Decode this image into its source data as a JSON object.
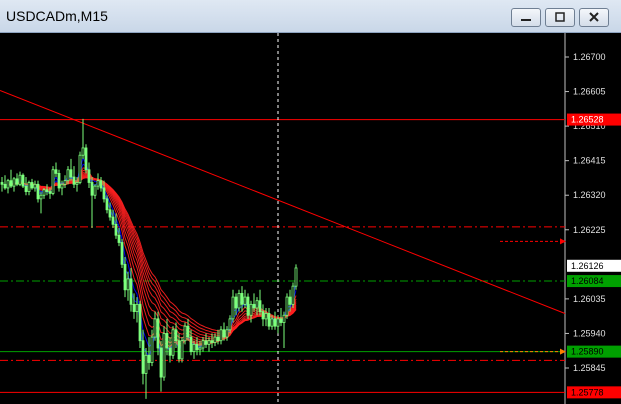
{
  "window": {
    "title": "USDCADm,M15"
  },
  "controls": [
    {
      "name": "minimize-button",
      "icon": "minimize-icon"
    },
    {
      "name": "restore-button",
      "icon": "restore-icon"
    },
    {
      "name": "close-button",
      "icon": "close-icon"
    }
  ],
  "colors": {
    "background": "#000000",
    "axis": "#c0c0c0",
    "grid": "#ffffff",
    "candle_bull": "#7cff7c",
    "candle_bear": "#7cff7c",
    "ribbon": "#ff2020",
    "ribbon_fast_bull": "#0000ff",
    "level_line": "#ff0000",
    "green_level": "#00a000"
  },
  "chart_data": {
    "type": "candlestick",
    "symbol": "USDCADm",
    "timeframe": "M15",
    "ylim": [
      1.25746,
      1.26766
    ],
    "price_ticks": [
      "1.26700",
      "1.26605",
      "1.26510",
      "1.26415",
      "1.26320",
      "1.26225",
      "1.26035",
      "1.25940",
      "1.25845",
      "1.25750"
    ],
    "current_price": "1.26126",
    "price_labels": [
      {
        "text": "1.26528",
        "price": 1.26528,
        "bg": "#ff0000",
        "fg": "#ffffff"
      },
      {
        "text": "1.26126",
        "price": 1.26126,
        "bg": "#ffffff",
        "fg": "#000000"
      },
      {
        "text": "1.26084",
        "price": 1.26084,
        "bg": "#00a000",
        "fg": "#000000"
      },
      {
        "text": "1.25890",
        "price": 1.2589,
        "bg": "#00a000",
        "fg": "#000000"
      },
      {
        "text": "1.25778",
        "price": 1.25778,
        "bg": "#ff0000",
        "fg": "#000000"
      }
    ],
    "horizontal_lines": [
      {
        "price": 1.26528,
        "style": "solid",
        "color": "#ff0000"
      },
      {
        "price": 1.26233,
        "style": "dashdot",
        "color": "#ff0000"
      },
      {
        "price": 1.26084,
        "style": "dashdot",
        "color": "#00a000"
      },
      {
        "price": 1.2589,
        "style": "solid",
        "color": "#00a000"
      },
      {
        "price": 1.25866,
        "style": "dashdot",
        "color": "#ff0000"
      },
      {
        "price": 1.25778,
        "style": "solid",
        "color": "#ff0000"
      }
    ],
    "trendline": {
      "from": [
        0,
        1.26606
      ],
      "to": [
        140,
        1.2615
      ],
      "color": "#ff0000"
    },
    "arrows": [
      {
        "price": 1.26193,
        "color": "#ff0000"
      },
      {
        "price": 1.2589,
        "color": "#ff8000"
      }
    ],
    "crosshair_bar": 92,
    "candles": [
      [
        1.26355,
        1.2637,
        1.2633,
        1.2635
      ],
      [
        1.2635,
        1.26375,
        1.26335,
        1.2634
      ],
      [
        1.2634,
        1.26365,
        1.26325,
        1.2636
      ],
      [
        1.2636,
        1.2639,
        1.2634,
        1.26345
      ],
      [
        1.26345,
        1.2637,
        1.2633,
        1.26365
      ],
      [
        1.26365,
        1.2638,
        1.26345,
        1.2635
      ],
      [
        1.2635,
        1.26385,
        1.26345,
        1.26375
      ],
      [
        1.26375,
        1.2638,
        1.2634,
        1.26345
      ],
      [
        1.26345,
        1.2637,
        1.2632,
        1.2633
      ],
      [
        1.2633,
        1.2636,
        1.2632,
        1.26355
      ],
      [
        1.26355,
        1.26365,
        1.26335,
        1.2634
      ],
      [
        1.2634,
        1.2636,
        1.2633,
        1.2635
      ],
      [
        1.2635,
        1.2636,
        1.263,
        1.2631
      ],
      [
        1.2631,
        1.2633,
        1.2627,
        1.2632
      ],
      [
        1.2632,
        1.2634,
        1.2631,
        1.26335
      ],
      [
        1.26335,
        1.2635,
        1.2632,
        1.2633
      ],
      [
        1.2633,
        1.2634,
        1.2631,
        1.26325
      ],
      [
        1.26325,
        1.264,
        1.2632,
        1.2639
      ],
      [
        1.2639,
        1.2641,
        1.2637,
        1.2638
      ],
      [
        1.2638,
        1.2639,
        1.2633,
        1.2634
      ],
      [
        1.2634,
        1.2636,
        1.2632,
        1.2635
      ],
      [
        1.2635,
        1.26375,
        1.2634,
        1.2636
      ],
      [
        1.2636,
        1.264,
        1.2635,
        1.2639
      ],
      [
        1.2639,
        1.2642,
        1.2636,
        1.2637
      ],
      [
        1.2637,
        1.264,
        1.2634,
        1.2635
      ],
      [
        1.2635,
        1.2637,
        1.2633,
        1.26355
      ],
      [
        1.26355,
        1.2644,
        1.2635,
        1.2643
      ],
      [
        1.2643,
        1.2653,
        1.2642,
        1.2645
      ],
      [
        1.2645,
        1.2646,
        1.2638,
        1.2639
      ],
      [
        1.2639,
        1.2641,
        1.2634,
        1.26355
      ],
      [
        1.26355,
        1.2637,
        1.2623,
        1.2632
      ],
      [
        1.2632,
        1.2635,
        1.2631,
        1.26345
      ],
      [
        1.26345,
        1.2638,
        1.26335,
        1.2636
      ],
      [
        1.2636,
        1.2637,
        1.2633,
        1.2634
      ],
      [
        1.2634,
        1.2636,
        1.263,
        1.2631
      ],
      [
        1.2631,
        1.2632,
        1.2627,
        1.2628
      ],
      [
        1.2628,
        1.263,
        1.2625,
        1.2626
      ],
      [
        1.2626,
        1.2628,
        1.2623,
        1.2624
      ],
      [
        1.2624,
        1.2627,
        1.262,
        1.2621
      ],
      [
        1.2621,
        1.2623,
        1.2618,
        1.2619
      ],
      [
        1.2619,
        1.262,
        1.2612,
        1.2613
      ],
      [
        1.2613,
        1.2615,
        1.2604,
        1.2606
      ],
      [
        1.2606,
        1.2611,
        1.2603,
        1.2609
      ],
      [
        1.2609,
        1.2612,
        1.26,
        1.2602
      ],
      [
        1.2602,
        1.2605,
        1.2598,
        1.26
      ],
      [
        1.26,
        1.2604,
        1.2597,
        1.2602
      ],
      [
        1.2602,
        1.2603,
        1.259,
        1.2592
      ],
      [
        1.2592,
        1.2595,
        1.258,
        1.2583
      ],
      [
        1.2583,
        1.259,
        1.2576,
        1.2588
      ],
      [
        1.2588,
        1.2593,
        1.2584,
        1.2586
      ],
      [
        1.2586,
        1.2595,
        1.2585,
        1.2593
      ],
      [
        1.2593,
        1.26,
        1.2592,
        1.2598
      ],
      [
        1.2598,
        1.26,
        1.2588,
        1.259
      ],
      [
        1.259,
        1.2592,
        1.2578,
        1.2582
      ],
      [
        1.2582,
        1.2596,
        1.2581,
        1.2594
      ],
      [
        1.2594,
        1.2598,
        1.2588,
        1.259
      ],
      [
        1.259,
        1.2593,
        1.2586,
        1.2588
      ],
      [
        1.2588,
        1.2596,
        1.2587,
        1.2595
      ],
      [
        1.2595,
        1.2597,
        1.259,
        1.2592
      ],
      [
        1.2592,
        1.2594,
        1.2586,
        1.2587
      ],
      [
        1.2587,
        1.2593,
        1.2586,
        1.2592
      ],
      [
        1.2592,
        1.2597,
        1.2591,
        1.2596
      ],
      [
        1.2596,
        1.2598,
        1.2592,
        1.2593
      ],
      [
        1.2593,
        1.2595,
        1.2588,
        1.2589
      ],
      [
        1.2589,
        1.2592,
        1.2587,
        1.2591
      ],
      [
        1.2591,
        1.2593,
        1.2588,
        1.25895
      ],
      [
        1.25895,
        1.2592,
        1.2588,
        1.259
      ],
      [
        1.259,
        1.2593,
        1.2589,
        1.2592
      ],
      [
        1.2592,
        1.2594,
        1.259,
        1.2591
      ],
      [
        1.2591,
        1.2593,
        1.2589,
        1.2592
      ],
      [
        1.2592,
        1.2594,
        1.259,
        1.25915
      ],
      [
        1.25915,
        1.2594,
        1.25905,
        1.2593
      ],
      [
        1.2593,
        1.2595,
        1.2591,
        1.2592
      ],
      [
        1.2592,
        1.2596,
        1.2591,
        1.2595
      ],
      [
        1.2595,
        1.2597,
        1.2592,
        1.2593
      ],
      [
        1.2593,
        1.2596,
        1.2592,
        1.2595
      ],
      [
        1.2595,
        1.2599,
        1.2594,
        1.2598
      ],
      [
        1.2598,
        1.2606,
        1.2597,
        1.2604
      ],
      [
        1.2604,
        1.2605,
        1.2599,
        1.2601
      ],
      [
        1.2601,
        1.2606,
        1.26,
        1.2605
      ],
      [
        1.2605,
        1.2607,
        1.26,
        1.2602
      ],
      [
        1.2602,
        1.2606,
        1.2601,
        1.2604
      ],
      [
        1.2604,
        1.2605,
        1.2598,
        1.2599
      ],
      [
        1.2599,
        1.2603,
        1.2597,
        1.2602
      ],
      [
        1.2602,
        1.2605,
        1.26,
        1.2601
      ],
      [
        1.2601,
        1.2604,
        1.2599,
        1.2603
      ],
      [
        1.2603,
        1.2606,
        1.2599,
        1.26
      ],
      [
        1.26,
        1.2602,
        1.2596,
        1.2598
      ],
      [
        1.2598,
        1.2601,
        1.2596,
        1.25995
      ],
      [
        1.25995,
        1.2601,
        1.2595,
        1.2596
      ],
      [
        1.2596,
        1.2599,
        1.2595,
        1.2598
      ],
      [
        1.2598,
        1.26,
        1.2595,
        1.2596
      ],
      [
        1.2596,
        1.2599,
        1.2594,
        1.2598
      ],
      [
        1.2598,
        1.2601,
        1.2596,
        1.2597
      ],
      [
        1.2597,
        1.26,
        1.259,
        1.2599
      ],
      [
        1.2599,
        1.2605,
        1.2598,
        1.2604
      ],
      [
        1.2604,
        1.2606,
        1.26,
        1.2602
      ],
      [
        1.2602,
        1.2608,
        1.2601,
        1.2607
      ],
      [
        1.2607,
        1.2613,
        1.2606,
        1.2612
      ]
    ]
  }
}
